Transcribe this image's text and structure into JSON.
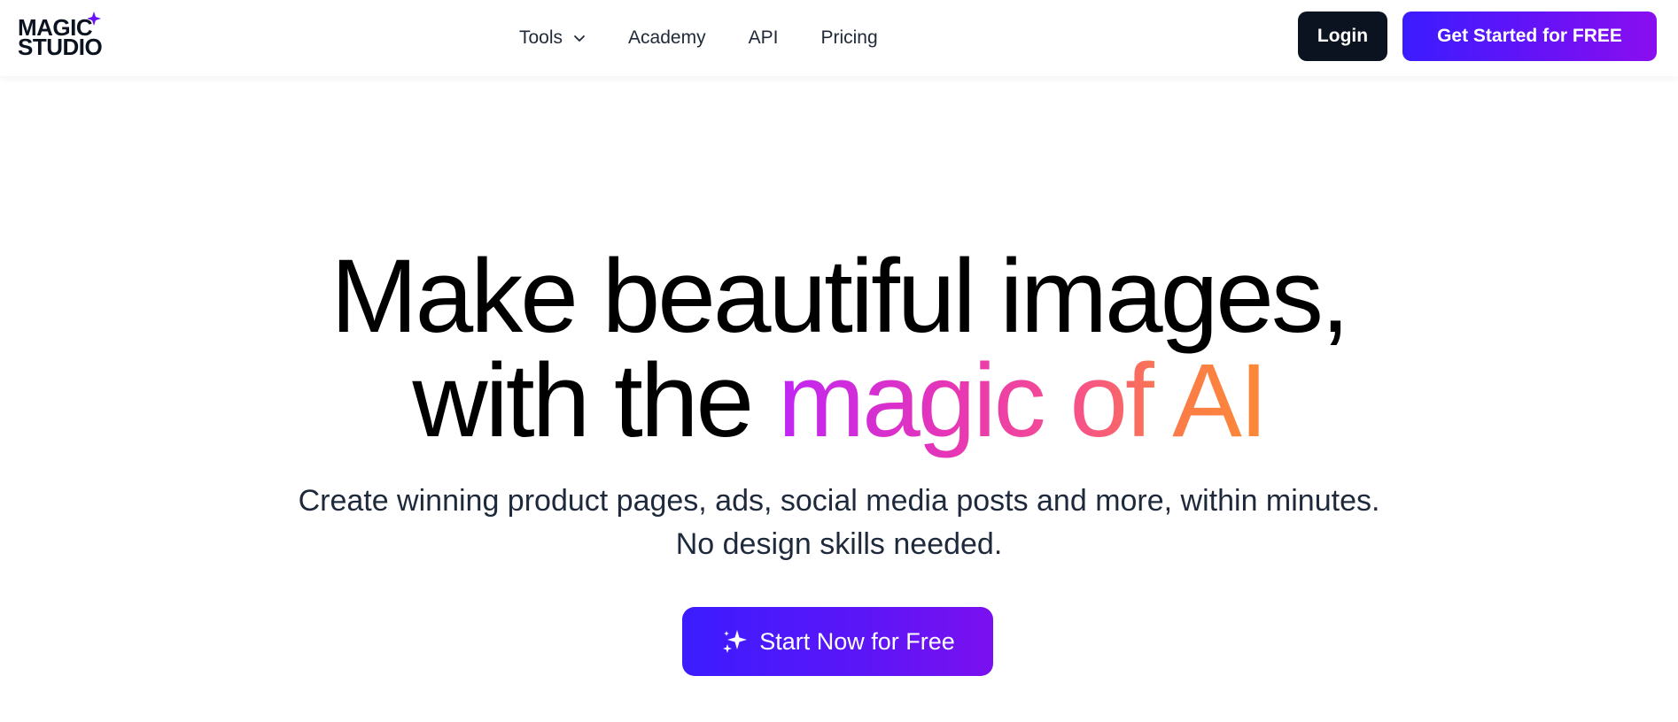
{
  "brand": {
    "logo_line1": "MAGIC",
    "logo_line2": "STUDIO",
    "accent_color": "#6a12f5",
    "dark_color": "#0b1220"
  },
  "nav": {
    "items": [
      {
        "label": "Tools",
        "has_dropdown": true,
        "icon": "chevron-down-icon"
      },
      {
        "label": "Academy"
      },
      {
        "label": "API"
      },
      {
        "label": "Pricing"
      }
    ]
  },
  "header_actions": {
    "login_label": "Login",
    "cta_label": "Get Started for FREE"
  },
  "hero": {
    "title_line1": "Make beautiful images,",
    "title_line2_plain": "with the ",
    "title_line2_highlight": "magic of AI",
    "subtitle_line1": "Create winning product pages, ads, social media posts and more, within minutes.",
    "subtitle_line2": "No design skills needed.",
    "cta_label": "Start Now for Free",
    "cta_icon": "sparkle-icon",
    "gradient_colors": [
      "#c026f5",
      "#e636b6",
      "#f64f8e",
      "#fb7a4a",
      "#fb8a36"
    ]
  }
}
